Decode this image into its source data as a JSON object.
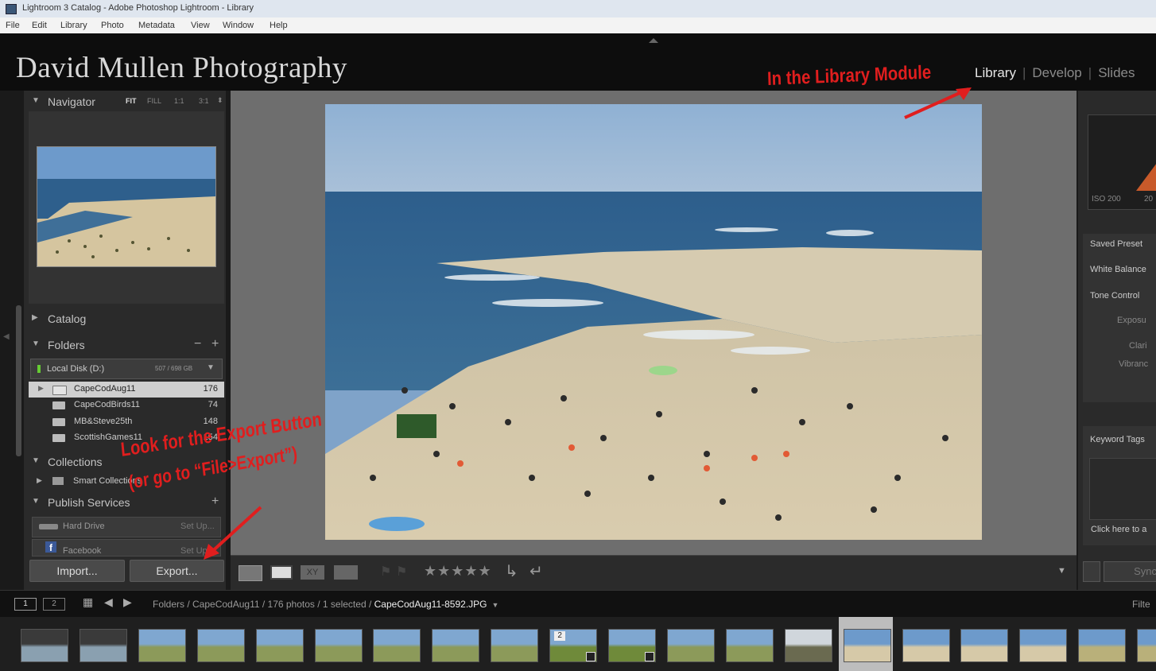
{
  "window": {
    "title": "Lightroom 3 Catalog - Adobe Photoshop Lightroom - Library",
    "menu": [
      "File",
      "Edit",
      "Library",
      "Photo",
      "Metadata",
      "View",
      "Window",
      "Help"
    ]
  },
  "identity": {
    "studio_name": "David Mullen Photography",
    "modules": [
      "Library",
      "Develop",
      "Slides"
    ],
    "active_module": "Library"
  },
  "left_panel": {
    "navigator": {
      "label": "Navigator",
      "zoom": [
        "FIT",
        "FILL",
        "1:1",
        "3:1"
      ]
    },
    "catalog": {
      "label": "Catalog"
    },
    "folders": {
      "label": "Folders",
      "volume": {
        "name": "Local Disk (D:)",
        "space": "507 / 698 GB"
      },
      "items": [
        {
          "name": "CapeCodAug11",
          "count": "176"
        },
        {
          "name": "CapeCodBirds11",
          "count": "74"
        },
        {
          "name": "MB&Steve25th",
          "count": "148"
        },
        {
          "name": "ScottishGames11",
          "count": "154"
        }
      ]
    },
    "collections": {
      "label": "Collections",
      "smart": "Smart Collections"
    },
    "publish": {
      "label": "Publish Services",
      "services": [
        {
          "name": "Hard Drive",
          "action": "Set Up..."
        },
        {
          "name": "Facebook",
          "action": "Set Up..."
        }
      ]
    },
    "import_label": "Import...",
    "export_label": "Export..."
  },
  "right_panel": {
    "histogram": {
      "iso": "ISO 200",
      "partial": "20"
    },
    "quick_develop": [
      "Saved Preset",
      "White Balance",
      "Tone Control"
    ],
    "tone_items": [
      "Exposu",
      "Clari",
      "Vibranc"
    ],
    "keyword_tags": "Keyword Tags",
    "keyword_hint": "Click here to a",
    "sync_label": "Sync"
  },
  "filmstrip": {
    "pages": [
      "1",
      "2"
    ],
    "breadcrumb": "Folders / CapeCodAug11 / 176 photos / 1 selected / ",
    "filename": "CapeCodAug11-8592.JPG",
    "filter_label": "Filte",
    "stack_badge": "2"
  },
  "annotations": {
    "library_note": "In the Library Module",
    "export_note_line1": "Look for the Export Button",
    "export_note_line2": "(or go to “File>Export”)"
  },
  "colors": {
    "annotation": "#e01e1e",
    "panel": "#2a2a2a",
    "background": "#6e6e6e"
  }
}
